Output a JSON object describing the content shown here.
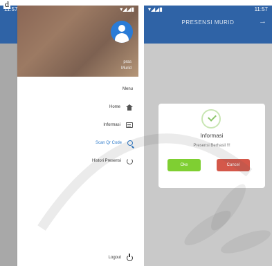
{
  "figure": {
    "label": "d"
  },
  "left_screen": {
    "status_bar": {
      "time": "11:57"
    },
    "drawer": {
      "user_name": "pras",
      "user_role": "Murid",
      "menu_heading": "Menu",
      "items": [
        {
          "label": "Home",
          "icon": "home-icon"
        },
        {
          "label": "Informasi",
          "icon": "info-card-icon"
        },
        {
          "label": "Scan Qr Code",
          "icon": "search-icon",
          "active": true
        },
        {
          "label": "Histori Presensi",
          "icon": "history-icon"
        }
      ],
      "logout_label": "Logout"
    }
  },
  "right_screen": {
    "status_bar": {
      "time": "11:57"
    },
    "app_bar": {
      "title": "PRESENSI MURID"
    },
    "dialog": {
      "title": "Informasi",
      "message": "Presensi Berhasil !!!",
      "ok_label": "Oke",
      "cancel_label": "Cancel"
    }
  },
  "colors": {
    "app_bar": "#2f63a6",
    "accent_blue": "#2a78c9",
    "ok_green": "#7fcf32",
    "cancel_red": "#d4584a"
  }
}
